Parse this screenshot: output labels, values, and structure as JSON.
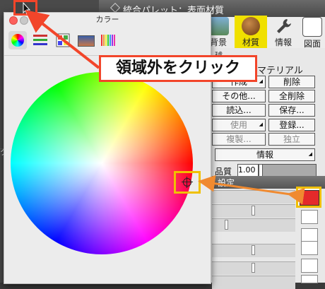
{
  "palette": {
    "title": "統合パレット：表面材質",
    "tabs": [
      {
        "label": "背景",
        "icon": "background-icon"
      },
      {
        "label": "材質",
        "icon": "material-sphere-icon",
        "active": true
      },
      {
        "label": "情報",
        "icon": "wrench-icon"
      },
      {
        "label": "図面",
        "icon": "drawing-icon"
      }
    ],
    "partial_labels": {
      "sphere_suffix": "球",
      "material": "マテリアル"
    },
    "buttons": {
      "new": "作成",
      "delete": "削除",
      "other": "その他...",
      "delete_all": "全削除",
      "load": "読込...",
      "save": "保存...",
      "use": "使用",
      "register": "登録...",
      "duplicate": "複製...",
      "independent": "独立",
      "info": "情報"
    },
    "quality": {
      "label": "品質",
      "value": "1.00"
    },
    "section_label": "設定",
    "swatch_color": "#e42a2a"
  },
  "colorwin": {
    "title": "カラー",
    "tools": [
      "color-wheel-icon",
      "sliders-icon",
      "palette-grid-icon",
      "image-palette-icon",
      "crayons-icon"
    ]
  },
  "callout": {
    "text": "領域外をクリック",
    "border_color": "#f2452a"
  },
  "left_partial": "ク"
}
